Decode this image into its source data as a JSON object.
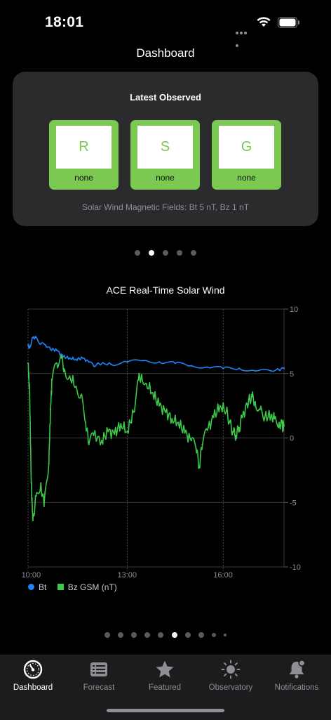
{
  "status_bar": {
    "time": "18:01"
  },
  "page_title": "Dashboard",
  "card": {
    "title": "Latest Observed",
    "scales": [
      {
        "letter": "R",
        "level": "none"
      },
      {
        "letter": "S",
        "level": "none"
      },
      {
        "letter": "G",
        "level": "none"
      }
    ],
    "footer": "Solar Wind Magnetic Fields: Bt 5 nT, Bz 1 nT",
    "scale_color": "#7bc950"
  },
  "card_pager": {
    "count": 5,
    "active": 1
  },
  "chart_pager": {
    "count": 10,
    "active": 5
  },
  "chart_data": {
    "type": "line",
    "title": "ACE Real-Time Solar Wind",
    "ylim": [
      -10,
      10
    ],
    "y_ticks": [
      "10",
      "5",
      "0",
      "-5",
      "-10"
    ],
    "x_ticks": [
      "10:00",
      "13:00",
      "16:00"
    ],
    "xlim_hours": [
      9.9,
      17.9
    ],
    "grid": true,
    "legend_placement": "bottom-left",
    "series": [
      {
        "name": "Bt",
        "color": "#1c84f5",
        "points": [
          [
            9.9,
            7.2
          ],
          [
            9.95,
            7.0
          ],
          [
            10.05,
            7.8
          ],
          [
            10.15,
            7.8
          ],
          [
            10.3,
            7.3
          ],
          [
            10.45,
            7.2
          ],
          [
            10.6,
            6.9
          ],
          [
            10.8,
            6.8
          ],
          [
            11.0,
            6.3
          ],
          [
            11.2,
            6.2
          ],
          [
            11.4,
            6.1
          ],
          [
            11.6,
            6.2
          ],
          [
            11.8,
            5.9
          ],
          [
            11.95,
            5.6
          ],
          [
            12.1,
            5.8
          ],
          [
            12.5,
            5.7
          ],
          [
            13.0,
            5.9
          ],
          [
            13.5,
            6.0
          ],
          [
            14.0,
            5.9
          ],
          [
            14.5,
            5.8
          ],
          [
            15.0,
            5.6
          ],
          [
            15.5,
            5.5
          ],
          [
            16.0,
            5.4
          ],
          [
            16.5,
            5.4
          ],
          [
            17.0,
            5.2
          ],
          [
            17.5,
            5.2
          ],
          [
            17.9,
            5.4
          ]
        ]
      },
      {
        "name": "Bz GSM (nT)",
        "color": "#3cc94a",
        "points": [
          [
            9.9,
            5.8
          ],
          [
            9.95,
            3.5
          ],
          [
            10.0,
            -3.5
          ],
          [
            10.05,
            -6.4
          ],
          [
            10.15,
            -4.5
          ],
          [
            10.3,
            -3.5
          ],
          [
            10.4,
            -5.3
          ],
          [
            10.55,
            -2.0
          ],
          [
            10.6,
            2.2
          ],
          [
            10.65,
            4.5
          ],
          [
            10.8,
            5.8
          ],
          [
            10.95,
            6.2
          ],
          [
            11.05,
            5.2
          ],
          [
            11.2,
            4.8
          ],
          [
            11.4,
            4.0
          ],
          [
            11.55,
            3.3
          ],
          [
            11.7,
            1.2
          ],
          [
            11.8,
            -0.5
          ],
          [
            11.95,
            0.2
          ],
          [
            12.2,
            -0.2
          ],
          [
            12.4,
            0.5
          ],
          [
            12.6,
            0.3
          ],
          [
            12.8,
            1.1
          ],
          [
            13.0,
            0.5
          ],
          [
            13.2,
            2.0
          ],
          [
            13.35,
            4.5
          ],
          [
            13.45,
            4.9
          ],
          [
            13.6,
            4.2
          ],
          [
            13.8,
            3.5
          ],
          [
            14.0,
            2.5
          ],
          [
            14.2,
            2.0
          ],
          [
            14.4,
            1.5
          ],
          [
            14.6,
            1.2
          ],
          [
            14.8,
            0.4
          ],
          [
            15.0,
            -0.2
          ],
          [
            15.15,
            -0.8
          ],
          [
            15.25,
            -2.2
          ],
          [
            15.35,
            -0.5
          ],
          [
            15.5,
            0.6
          ],
          [
            15.7,
            1.6
          ],
          [
            15.9,
            2.5
          ],
          [
            16.1,
            2.1
          ],
          [
            16.2,
            1.2
          ],
          [
            16.3,
            0.5
          ],
          [
            16.4,
            0.2
          ],
          [
            16.5,
            0.8
          ],
          [
            16.6,
            1.6
          ],
          [
            16.8,
            3.0
          ],
          [
            16.9,
            3.2
          ],
          [
            17.0,
            2.8
          ],
          [
            17.15,
            2.2
          ],
          [
            17.3,
            1.6
          ],
          [
            17.5,
            1.8
          ],
          [
            17.6,
            1.5
          ],
          [
            17.75,
            1.2
          ],
          [
            17.85,
            0.9
          ],
          [
            17.9,
            1.0
          ]
        ]
      }
    ]
  },
  "tabs": [
    {
      "label": "Dashboard",
      "icon": "gauge-icon",
      "active": true
    },
    {
      "label": "Forecast",
      "icon": "list-document-icon",
      "active": false
    },
    {
      "label": "Featured",
      "icon": "star-icon",
      "active": false
    },
    {
      "label": "Observatory",
      "icon": "sun-icon",
      "active": false
    },
    {
      "label": "Notifications",
      "icon": "bell-badge-icon",
      "active": false
    }
  ]
}
